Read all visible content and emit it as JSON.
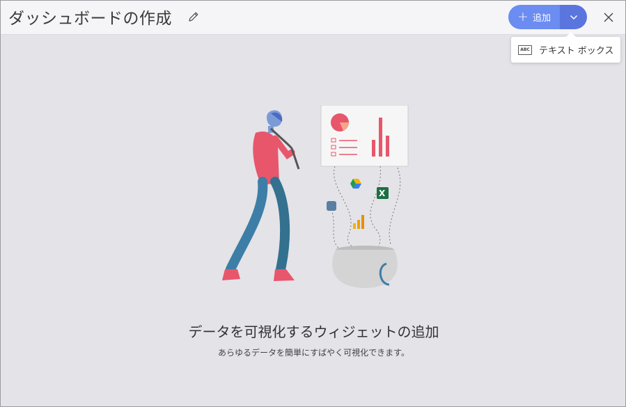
{
  "header": {
    "title": "ダッシュボードの作成"
  },
  "toolbar": {
    "add_label": "追加"
  },
  "dropdown": {
    "items": [
      {
        "icon_text": "ABC",
        "label": "テキスト ボックス"
      }
    ]
  },
  "empty_state": {
    "headline": "データを可視化するウィジェットの追加",
    "description": "あらゆるデータを簡単にすばやく可視化できます。"
  },
  "colors": {
    "primary": "#6b8cf1",
    "primary_dark": "#5a75dd",
    "background": "#e3e3e8",
    "header_bg": "#f5f5f7"
  },
  "icons": [
    "edit-pencil-icon",
    "plus-icon",
    "chevron-down-icon",
    "close-icon",
    "text-box-icon"
  ]
}
